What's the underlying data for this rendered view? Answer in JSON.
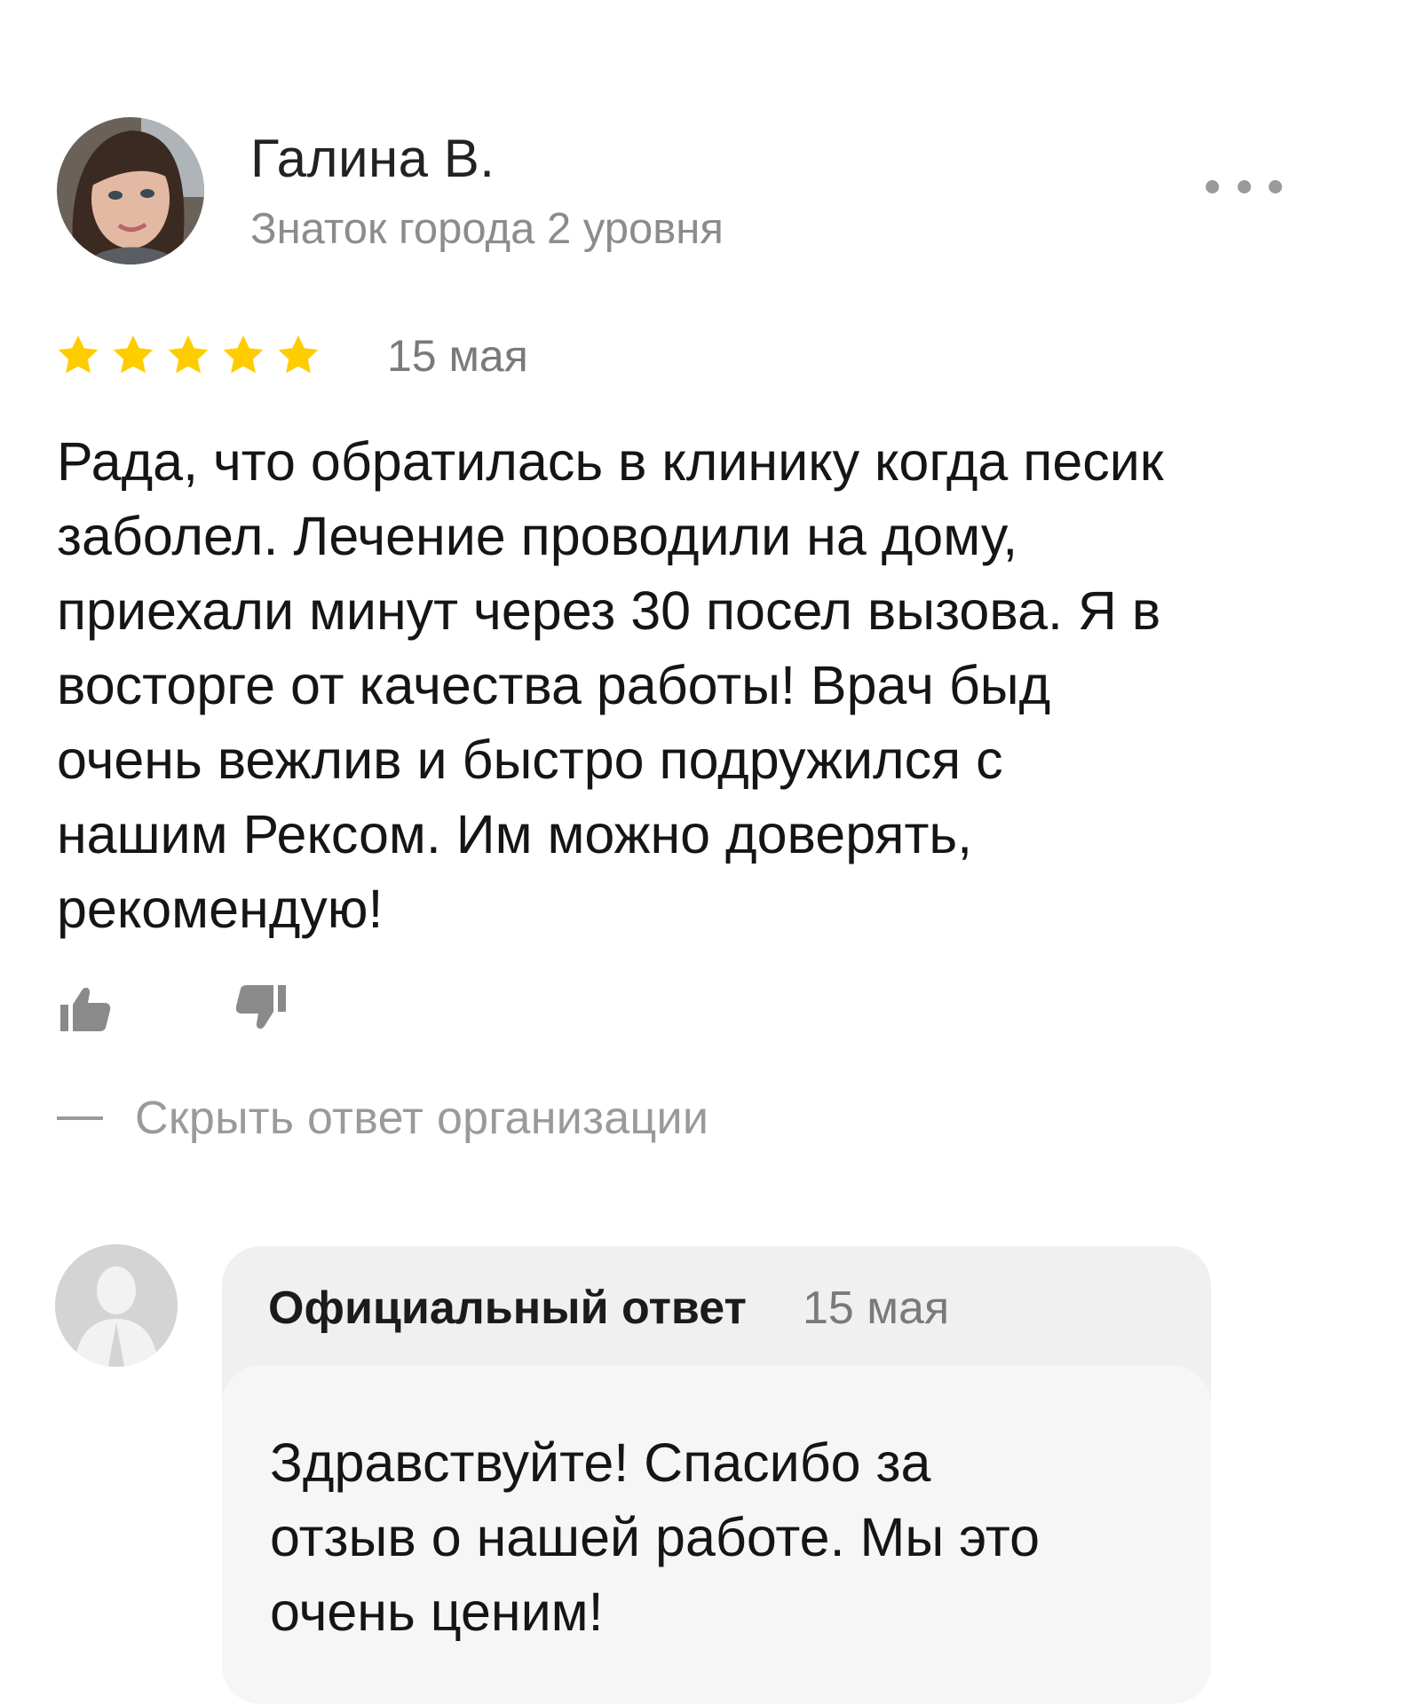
{
  "review": {
    "author": {
      "name": "Галина В.",
      "level": "Знаток города 2 уровня"
    },
    "rating": 5,
    "rating_max": 5,
    "date": "15 мая",
    "text_lines": [
      "Рада, что обратилась в клинику когда песик",
      "заболел. Лечение проводили на дому,",
      "приехали минут через 30 посел вызова. Я в",
      "восторге от качества работы! Врач быд",
      "очень вежлив и быстро подружился с",
      "нашим Рексом. Им можно доверять,",
      "рекомендую!"
    ]
  },
  "actions": {
    "hide_answer_label": "Скрыть ответ организации"
  },
  "official_reply": {
    "title": "Официальный ответ",
    "date": "15 мая",
    "text_lines": [
      "Здравствуйте! Спасибо за",
      "отзыв о нашей работе. Мы это",
      "очень ценим!"
    ]
  },
  "colors": {
    "star": "#ffcc00",
    "muted_text": "#8c8c8c",
    "reply_header_bg": "#f0f0f0",
    "reply_body_bg": "#f6f6f6"
  },
  "icons": {
    "more": "more-dots-icon",
    "like": "thumb-up-icon",
    "dislike": "thumb-down-icon",
    "org_avatar": "user-silhouette-icon"
  }
}
